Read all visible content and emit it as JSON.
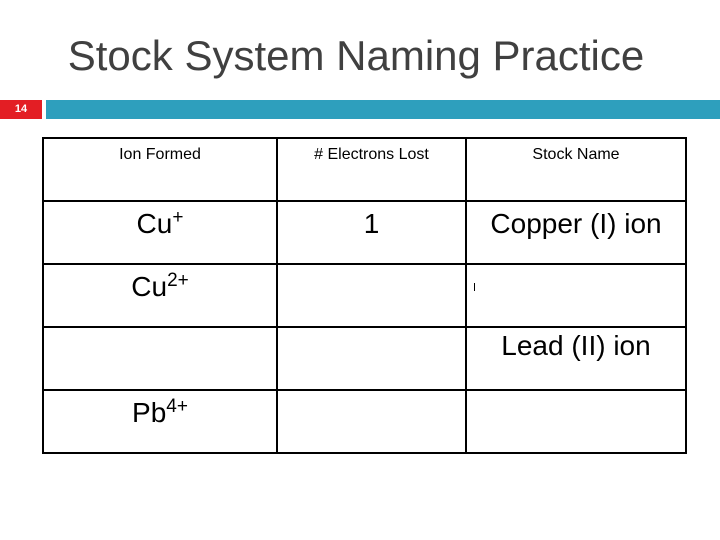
{
  "slide": {
    "title": "Stock System Naming Practice",
    "slide_number": "14",
    "colors": {
      "number_box": "#e31e24",
      "header_bar": "#2e9fbd",
      "title_text": "#404040"
    }
  },
  "table": {
    "headers": [
      "Ion Formed",
      "# Electrons Lost",
      "Stock Name"
    ],
    "rows": [
      {
        "ion_symbol": "Cu",
        "ion_charge": "+",
        "electrons_lost": "1",
        "stock_name": "Copper (I) ion"
      },
      {
        "ion_symbol": "Cu",
        "ion_charge": "2+",
        "electrons_lost": "",
        "stock_name": ""
      },
      {
        "ion_symbol": "",
        "ion_charge": "",
        "electrons_lost": "",
        "stock_name": "Lead (II) ion"
      },
      {
        "ion_symbol": "Pb",
        "ion_charge": "4+",
        "electrons_lost": "",
        "stock_name": ""
      }
    ]
  }
}
